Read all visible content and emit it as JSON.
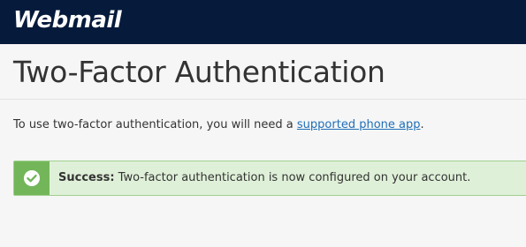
{
  "header": {
    "logo_text": "Webmail",
    "background": "#061b3c"
  },
  "page": {
    "title": "Two-Factor Authentication",
    "intro_prefix": "To use two-factor authentication, you will need a ",
    "intro_link": "supported phone app",
    "intro_suffix": "."
  },
  "alert": {
    "status": "success",
    "icon": "check-circle-icon",
    "label": "Success:",
    "message": " Two-factor authentication is now configured on your account.",
    "color": "#73b659"
  }
}
